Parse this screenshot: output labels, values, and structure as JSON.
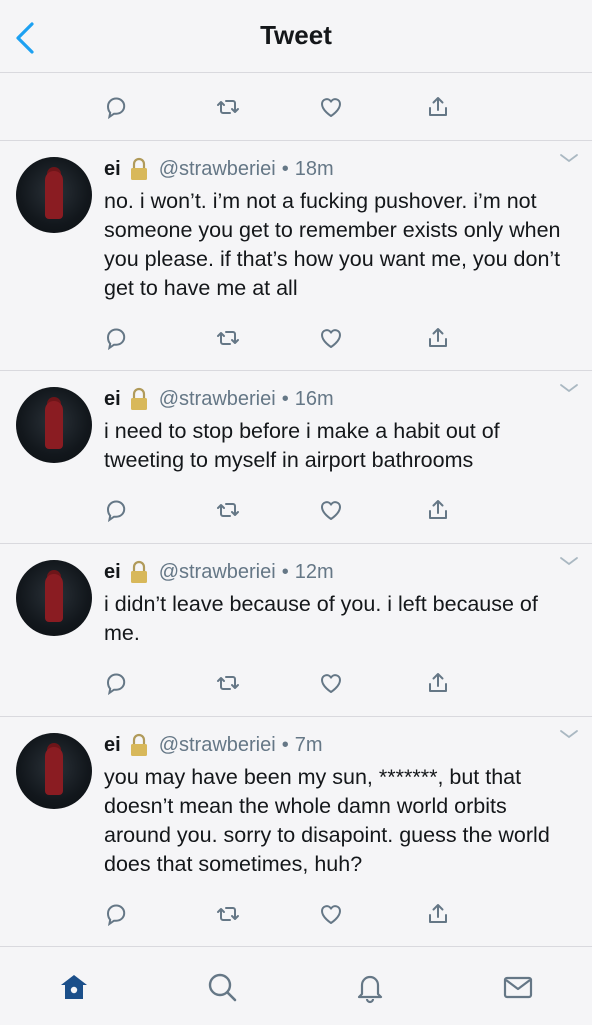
{
  "header": {
    "title": "Tweet"
  },
  "tweets": [
    {
      "name": "ei",
      "handle": "@strawberiei",
      "separator": "•",
      "time": "18m",
      "text": "no. i won’t. i’m not a fucking pushover. i’m not someone you get to remember exists only when you please. if that’s how you want me, you don’t get to have me at all"
    },
    {
      "name": "ei",
      "handle": "@strawberiei",
      "separator": "•",
      "time": "16m",
      "text": "i need to stop before i make a habit out of tweeting to myself in airport bathrooms"
    },
    {
      "name": "ei",
      "handle": "@strawberiei",
      "separator": "•",
      "time": "12m",
      "text": "i didn’t leave because of you. i left because of me."
    },
    {
      "name": "ei",
      "handle": "@strawberiei",
      "separator": "•",
      "time": "7m",
      "text": "you may have been my sun, *******, but that doesn’t mean the whole damn world orbits around you. sorry to disapoint. guess the world does that sometimes, huh?"
    }
  ],
  "colors": {
    "accent": "#1da1f2",
    "icon": "#657786",
    "home_active": "#1b4f8a"
  },
  "tabbar": {
    "items": [
      "home-icon",
      "search-icon",
      "notifications-icon",
      "messages-icon"
    ],
    "active": "home"
  }
}
